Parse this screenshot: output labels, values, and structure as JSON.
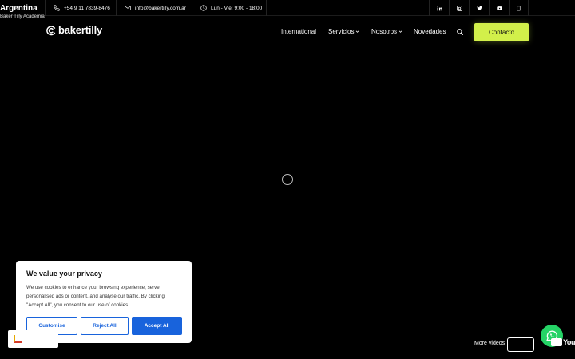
{
  "brand": {
    "country": "Argentina",
    "sub": "Baker Tilly Academia"
  },
  "topbar": {
    "phone": "+54 9 11 7839-8476",
    "email": "info@bakertilly.com.ar",
    "hours": "Lun - Vie: 9:00 - 18:00",
    "socials": [
      "linkedin-icon",
      "instagram-icon",
      "twitter-icon",
      "youtube-icon",
      "tiktok-icon"
    ]
  },
  "logo": {
    "text": "bakertilly"
  },
  "nav": {
    "international": "International",
    "servicios": "Servicios",
    "nosotros": "Nosotros",
    "novedades": "Novedades",
    "contact": "Contacto"
  },
  "cookie": {
    "title": "We value your privacy",
    "body": "We use cookies to enhance your browsing experience, serve personalised ads or content, and analyse our traffic. By clicking \"Accept All\", you consent to our use of cookies.",
    "customise": "Customise",
    "reject": "Reject All",
    "accept": "Accept All"
  },
  "footer": {
    "more_videos": "More videos",
    "youtube": "YouTube"
  },
  "colors": {
    "accent": "#d2f04a",
    "cookie_blue": "#1863dc",
    "whatsapp": "#25d366"
  }
}
